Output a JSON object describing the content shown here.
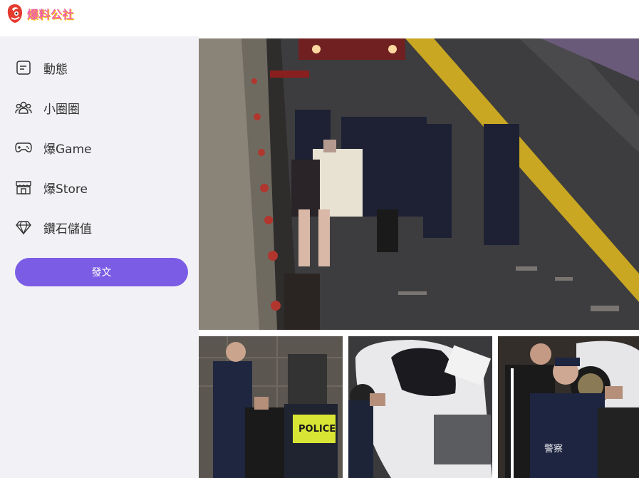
{
  "brand": {
    "logo_text": "爆料公社"
  },
  "sidebar": {
    "items": [
      {
        "label": "動態",
        "icon": "feed-icon"
      },
      {
        "label": "小圈圈",
        "icon": "groups-icon"
      },
      {
        "label": "爆Game",
        "icon": "gamepad-icon"
      },
      {
        "label": "爆Store",
        "icon": "store-icon"
      },
      {
        "label": "鑽石儲值",
        "icon": "diamond-icon"
      }
    ],
    "post_button_label": "發文"
  },
  "gallery": {
    "photos": [
      {
        "description_icon": "main-photo",
        "police_text": ""
      },
      {
        "description_icon": "photo-2",
        "police_text": "POLICE"
      },
      {
        "description_icon": "photo-3",
        "police_text": ""
      },
      {
        "description_icon": "photo-4",
        "police_text": "警察"
      }
    ]
  },
  "colors": {
    "accent": "#7b5ce5",
    "sidebar_bg": "#f2f2f6",
    "logo_pink": "#f062a8"
  }
}
